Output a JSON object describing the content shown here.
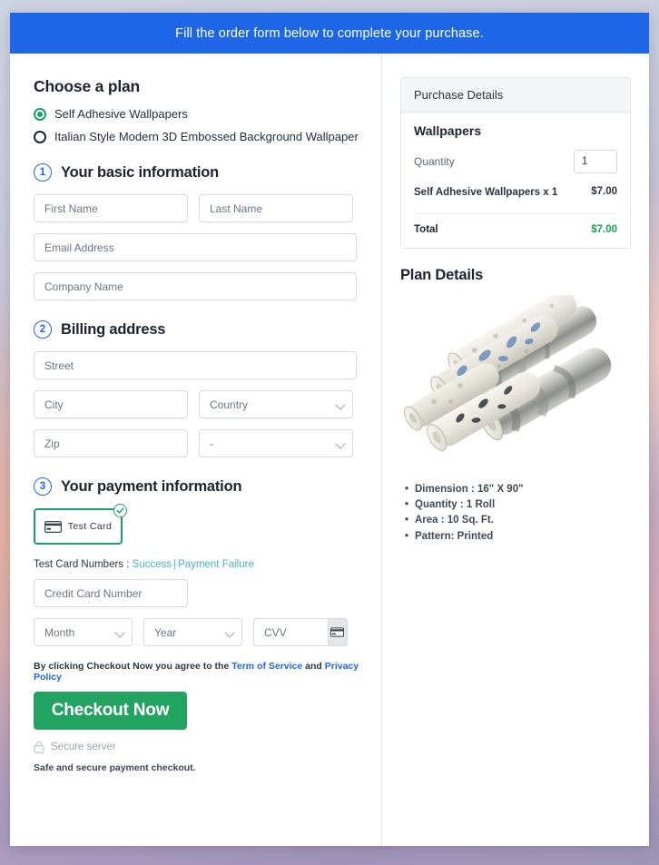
{
  "banner": {
    "text": "Fill the order form below to complete your purchase."
  },
  "plan": {
    "heading": "Choose a plan",
    "options": [
      {
        "label": "Self Adhesive Wallpapers",
        "selected": true
      },
      {
        "label": "Italian Style Modern 3D Embossed Background Wallpaper",
        "selected": false
      }
    ]
  },
  "steps": {
    "basic": {
      "num": "1",
      "title": "Your basic information"
    },
    "billing": {
      "num": "2",
      "title": "Billing address"
    },
    "payment": {
      "num": "3",
      "title": "Your payment information"
    }
  },
  "fields": {
    "first_name": {
      "placeholder": "First Name",
      "value": ""
    },
    "last_name": {
      "placeholder": "Last Name",
      "value": ""
    },
    "email": {
      "placeholder": "Email Address",
      "value": ""
    },
    "company": {
      "placeholder": "Company Name",
      "value": ""
    },
    "street": {
      "placeholder": "Street",
      "value": ""
    },
    "city": {
      "placeholder": "City",
      "value": ""
    },
    "country": {
      "placeholder": "Country",
      "value": "Country"
    },
    "zip": {
      "placeholder": "Zip",
      "value": ""
    },
    "state": {
      "placeholder": "-",
      "value": "-"
    },
    "card_number": {
      "placeholder": "Credit Card Number",
      "value": ""
    },
    "month": {
      "placeholder": "Month",
      "value": "Month"
    },
    "year": {
      "placeholder": "Year",
      "value": "Year"
    },
    "cvv": {
      "placeholder": "CVV",
      "value": ""
    }
  },
  "payment_method": {
    "label": "Test Card",
    "selected": true
  },
  "test_numbers": {
    "prefix": "Test Card Numbers : ",
    "success": "Success",
    "separator": "|",
    "failure": "Payment Failure"
  },
  "terms": {
    "lead": "By clicking Checkout Now you agree to the ",
    "tos": "Term of Service",
    "and": " and ",
    "privacy": "Privacy Policy"
  },
  "checkout": {
    "label": "Checkout Now"
  },
  "secure": {
    "label": "Secure server",
    "note": "Safe and secure payment checkout."
  },
  "purchase": {
    "header": "Purchase Details",
    "title": "Wallpapers",
    "quantity_label": "Quantity",
    "quantity_value": "1",
    "line_item_name": "Self Adhesive Wallpapers x 1",
    "line_item_price": "$7.00",
    "total_label": "Total",
    "total_value": "$7.00"
  },
  "plan_details": {
    "title": "Plan Details",
    "bullets": [
      "Dimension : 16\" X 90\"",
      "Quantity : 1 Roll",
      "Area : 10 Sq. Ft.",
      "Pattern: Printed"
    ]
  },
  "colors": {
    "banner_blue": "#1e66e8",
    "accent_green": "#22a362",
    "link_blue": "#1e66e8",
    "link_teal": "#46b3c4",
    "total_green": "#16a34a"
  }
}
